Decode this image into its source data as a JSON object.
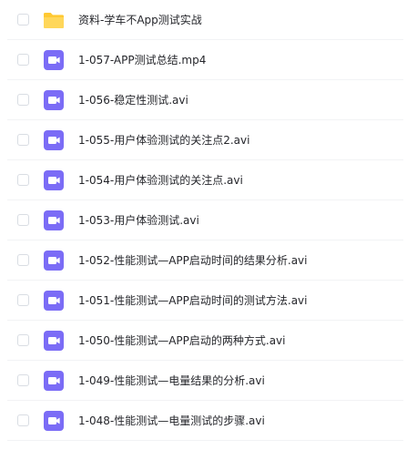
{
  "colors": {
    "folder": "#ffc933",
    "video_icon_bg": "#7b6cf6",
    "video_icon_fg": "#ffffff",
    "text": "#25262b",
    "divider": "#f2f3f5",
    "checkbox_border": "#d9dde3"
  },
  "files": [
    {
      "icon": "folder-icon",
      "name": "资料-学车不App测试实战"
    },
    {
      "icon": "video-file-icon",
      "name": "1-057-APP测试总结.mp4"
    },
    {
      "icon": "video-file-icon",
      "name": "1-056-稳定性测试.avi"
    },
    {
      "icon": "video-file-icon",
      "name": "1-055-用户体验测试的关注点2.avi"
    },
    {
      "icon": "video-file-icon",
      "name": "1-054-用户体验测试的关注点.avi"
    },
    {
      "icon": "video-file-icon",
      "name": "1-053-用户体验测试.avi"
    },
    {
      "icon": "video-file-icon",
      "name": "1-052-性能测试—APP启动时间的结果分析.avi"
    },
    {
      "icon": "video-file-icon",
      "name": "1-051-性能测试—APP启动时间的测试方法.avi"
    },
    {
      "icon": "video-file-icon",
      "name": "1-050-性能测试—APP启动的两种方式.avi"
    },
    {
      "icon": "video-file-icon",
      "name": "1-049-性能测试—电量结果的分析.avi"
    },
    {
      "icon": "video-file-icon",
      "name": "1-048-性能测试—电量测试的步骤.avi"
    }
  ]
}
